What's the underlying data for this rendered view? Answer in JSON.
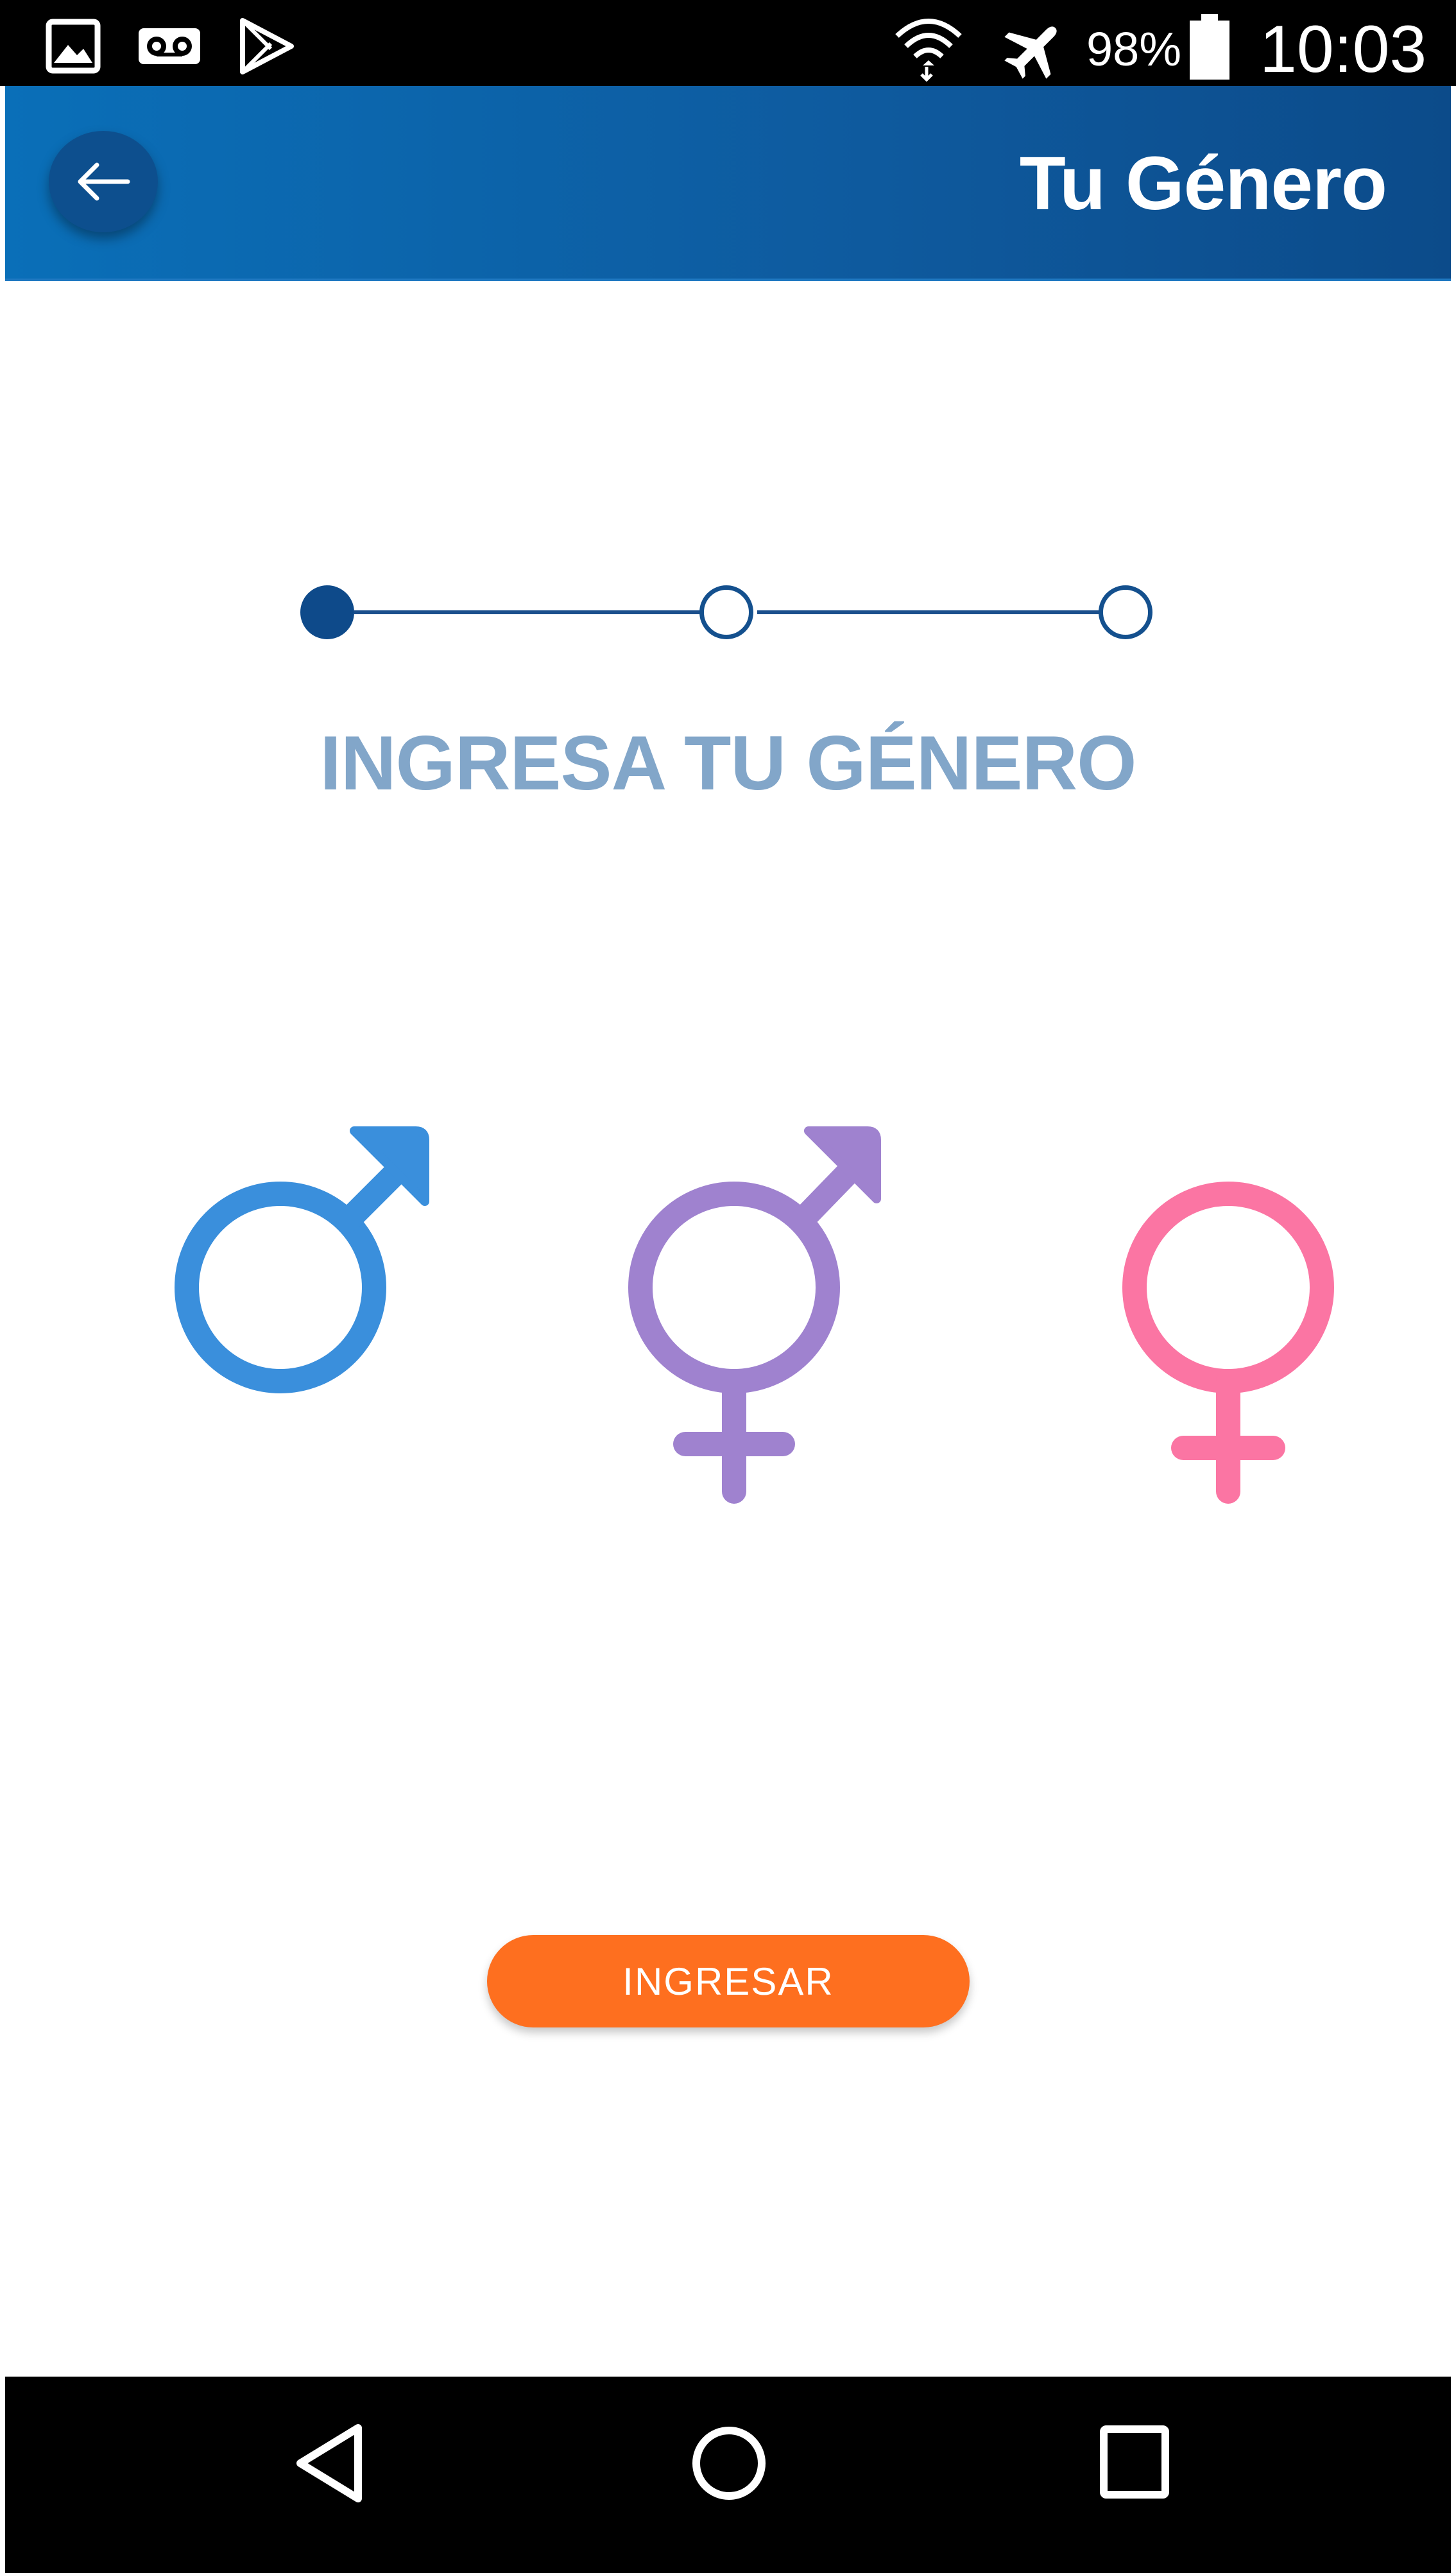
{
  "status_bar": {
    "icons": [
      "image-icon",
      "voicemail-icon",
      "play-store-icon",
      "wifi-icon",
      "airplane-mode-icon",
      "battery-icon"
    ],
    "battery_percent": "98%",
    "time": "10:03"
  },
  "app_bar": {
    "back_icon": "arrow-left-icon",
    "title": "Tu Género"
  },
  "stepper": {
    "steps": 3,
    "current_step": 1
  },
  "prompt": {
    "heading": "INGRESA TU GÉNERO"
  },
  "gender_options": [
    {
      "icon": "male-symbol-icon",
      "color": "#3a8fdc"
    },
    {
      "icon": "transgender-symbol-icon",
      "color": "#9f82cf"
    },
    {
      "icon": "female-symbol-icon",
      "color": "#fb75a3"
    }
  ],
  "submit": {
    "label": "INGRESAR",
    "color": "#fe6f1f"
  },
  "nav_bar": {
    "buttons": [
      "back-triangle-icon",
      "home-circle-icon",
      "recents-square-icon"
    ]
  },
  "colors": {
    "app_bar": "#0c5ea6",
    "stepper_active": "#0e4a8a",
    "heading": "#82a6c9"
  }
}
